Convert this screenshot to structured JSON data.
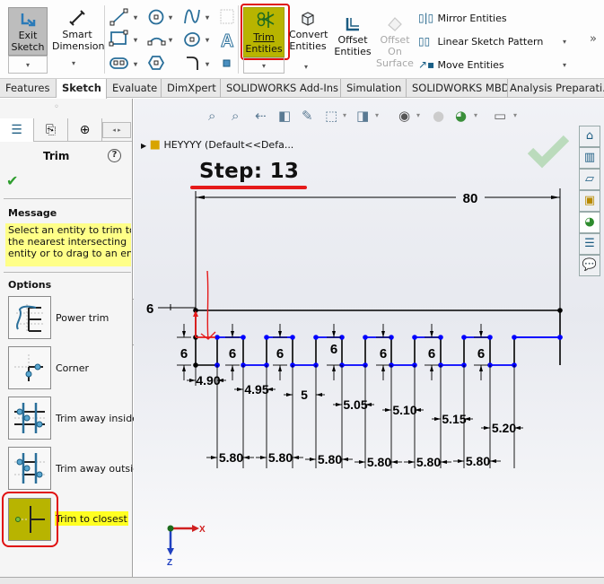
{
  "ribbon": {
    "exit_sketch": [
      "Exit",
      "Sketch"
    ],
    "smart_dimension": [
      "Smart",
      "Dimension"
    ],
    "trim_entities": [
      "Trim",
      "Entities"
    ],
    "convert_entities": [
      "Convert",
      "Entities"
    ],
    "offset_entities": [
      "Offset",
      "Entities"
    ],
    "offset_on_surface": [
      "Offset",
      "On",
      "Surface"
    ],
    "mirror_entities": "Mirror Entities",
    "linear_sketch_pattern": "Linear Sketch Pattern",
    "move_entities": "Move Entities",
    "overflow": "»",
    "dropdown_glyph": "▾",
    "sketch_tools": [
      "line",
      "center-circle",
      "spline",
      "construction-grid",
      "rectangle",
      "arc",
      "ellipse",
      "text",
      "slot",
      "polygon",
      "fillet",
      "point"
    ]
  },
  "command_tabs": [
    {
      "label": "Features",
      "active": false
    },
    {
      "label": "Sketch",
      "active": true
    },
    {
      "label": "Evaluate",
      "active": false
    },
    {
      "label": "DimXpert",
      "active": false
    },
    {
      "label": "SOLIDWORKS Add-Ins",
      "active": false
    },
    {
      "label": "Simulation",
      "active": false
    },
    {
      "label": "SOLIDWORKS MBD",
      "active": false
    },
    {
      "label": "Analysis Preparati...",
      "active": false
    }
  ],
  "property_manager": {
    "title": "Trim",
    "help": "?",
    "ok": "✔",
    "message_header": "Message",
    "message_lines": [
      "Select an entity to trim to",
      "the nearest intersecting",
      "entity or to drag to an enti"
    ],
    "options_header": "Options",
    "options": [
      {
        "label": "Power trim",
        "selected": false
      },
      {
        "label": "Corner",
        "selected": false
      },
      {
        "label": "Trim away inside",
        "selected": false
      },
      {
        "label": "Trim away outsic",
        "selected": false
      },
      {
        "label": "Trim to closest",
        "selected": true
      }
    ]
  },
  "viewport": {
    "tree_node": "HEYYYY  (Default<<Defa...",
    "step_label": "Step: 13",
    "triad": {
      "x": "X",
      "z": "Z"
    }
  },
  "sketch": {
    "overall_width": "80",
    "top_offset": "6",
    "tooth_heights": [
      "6",
      "6",
      "6",
      "6",
      "6",
      "6",
      "6"
    ],
    "gap_dims": [
      "4.90",
      "4.95",
      "5",
      "5.05",
      "5.10",
      "5.15",
      "5.20"
    ],
    "tooth_dims": [
      "5.80",
      "5.80",
      "5.80",
      "5.80",
      "5.80",
      "5.80"
    ],
    "line_color": "#0000ff",
    "fixed_color": "#000000",
    "annotation_color": "#e51a1a"
  },
  "task_pane": [
    "home",
    "3d-content",
    "file-explorer",
    "view-palette",
    "appearances",
    "custom-properties",
    "forum"
  ]
}
